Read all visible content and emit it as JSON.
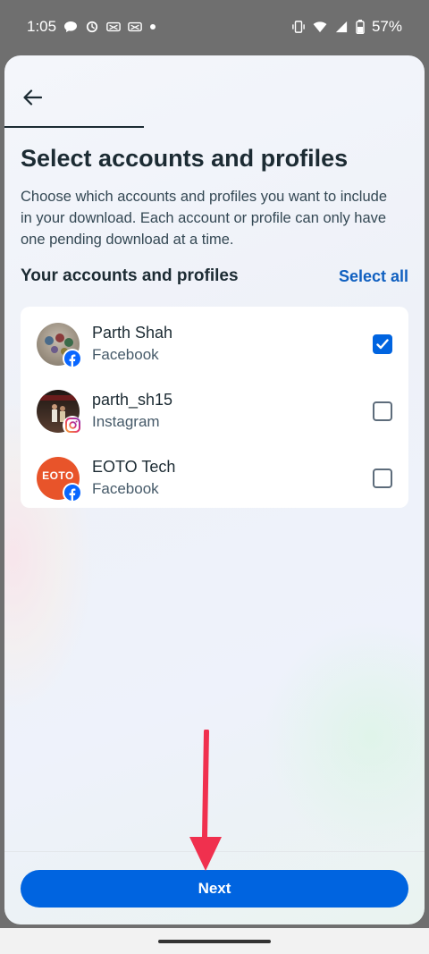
{
  "status_bar": {
    "time": "1:05",
    "battery": "57%",
    "icons": [
      "chat-bubble-icon",
      "clock-icon",
      "recording-icon",
      "recording-icon",
      "dot-icon",
      "vibrate-icon",
      "wifi-icon",
      "signal-icon",
      "battery-icon"
    ]
  },
  "header": {
    "back_icon": "arrow-left-icon",
    "title": "Select accounts and profiles",
    "description": "Choose which accounts and profiles you want to include in your download. Each account or profile can only have one pending download at a time."
  },
  "section": {
    "title": "Your accounts and profiles",
    "select_all": "Select all"
  },
  "accounts": [
    {
      "name": "Parth Shah",
      "platform": "Facebook",
      "checked": true,
      "badge": "facebook-icon",
      "avatar_color": "#a89c8c"
    },
    {
      "name": "parth_sh15",
      "platform": "Instagram",
      "checked": false,
      "badge": "instagram-icon",
      "avatar_color": "#3a2a22"
    },
    {
      "name": "EOTO Tech",
      "platform": "Facebook",
      "checked": false,
      "badge": "facebook-icon",
      "avatar_color": "#e8542a",
      "logo_text": "EOTO"
    }
  ],
  "footer": {
    "next_label": "Next"
  },
  "colors": {
    "primary": "#0064e0",
    "annotation_arrow": "#f0304e"
  }
}
